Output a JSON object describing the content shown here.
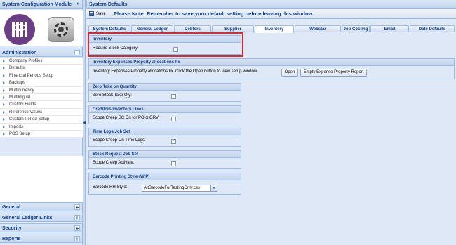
{
  "left_panel": {
    "title": "System Configuration Module",
    "administration": {
      "title": "Administration",
      "toggle": "−",
      "items": [
        "Company Profiles",
        "Defaults",
        "Financial Periods Setup",
        "Backups",
        "Multicurrency",
        "Multilingual",
        "Custom Fields",
        "Reference Values",
        "Custom Period Setup",
        "Imports",
        "POS Setup"
      ]
    },
    "collapsed_sections": [
      {
        "title": "General",
        "toggle": "+"
      },
      {
        "title": "General Ledger Links",
        "toggle": "+"
      },
      {
        "title": "Security",
        "toggle": "+"
      },
      {
        "title": "Reports",
        "toggle": "+"
      }
    ]
  },
  "main": {
    "title": "System Defaults",
    "toolbar": {
      "save_label": "Save",
      "note": "Please Note: Remember to save your default setting before leaving this window."
    },
    "tabs": [
      {
        "label": "System Defaults",
        "active": false
      },
      {
        "label": "General Ledger",
        "active": false
      },
      {
        "label": "Debtors",
        "active": false
      },
      {
        "label": "Supplier",
        "active": false
      },
      {
        "label": "Inventory",
        "active": true
      },
      {
        "label": "Webstar",
        "active": false
      },
      {
        "label": "Job Costing",
        "active": false
      },
      {
        "label": "Email",
        "active": false
      },
      {
        "label": "Date Defaults",
        "active": false
      }
    ],
    "sections": {
      "inventory": {
        "title": "Inventory",
        "field_label": "Require Stock Category:",
        "checked": false
      },
      "expenses": {
        "title": "Inventory Expenses Property allocations fix",
        "description": "Inventory Expenses Property allocations fix. Click the Open button to view setup window.",
        "open_label": "Open",
        "empty_label": "Empty Expense Property Report"
      },
      "zero_take": {
        "title": "Zero Take on Quantity",
        "field_label": "Zero Stock Take Qty:",
        "checked": false
      },
      "creditors": {
        "title": "Creditors Inventory Lines",
        "field_label": "Scope Creep SC On for PO & GRV:",
        "checked": false
      },
      "time_logs": {
        "title": "Time Logs Job Set",
        "field_label": "Scope Creep On Time Logs:",
        "checked": true
      },
      "stock_request": {
        "title": "Stock Request Job Set",
        "field_label": "Scope Creep Activate:",
        "checked": false
      },
      "barcode": {
        "title": "Barcode Printing Style (WIP)",
        "field_label": "Barcode RH Style:",
        "value": "AltBarcodeForTestingOnly.css"
      }
    }
  },
  "colors": {
    "accent": "#15428b",
    "panel_bg": "#dfe8f6",
    "border": "#99bbe8",
    "highlight": "#e4262c",
    "logo_purple": "#6a3f85"
  },
  "icons": {
    "save": "save-disk-icon",
    "collapse": "collapse-toggle-icon",
    "expand": "expand-toggle-icon",
    "dropdown": "chevron-down-icon"
  }
}
